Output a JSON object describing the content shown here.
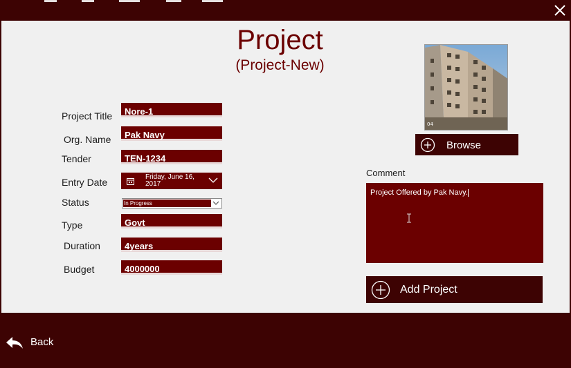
{
  "window": {
    "close_icon": "close-icon"
  },
  "header": {
    "title": "Project",
    "subtitle": "(Project-New)"
  },
  "form": {
    "project_title_label": "Project Title",
    "project_title_value": "Nore-1",
    "org_name_label": "Org. Name",
    "org_name_value": "Pak Navy",
    "tender_label": "Tender",
    "tender_value": "TEN-1234",
    "entry_date_label": "Entry Date",
    "entry_date_value": "Friday, June 16, 2017",
    "status_label": "Status",
    "status_value": "In Progress",
    "type_label": "Type",
    "type_value": "Govt",
    "duration_label": "Duration",
    "duration_value": "4years",
    "budget_label": "Budget",
    "budget_value": "4000000"
  },
  "photo": {
    "overlay_text": "04"
  },
  "buttons": {
    "browse": "Browse",
    "add_project": "Add Project",
    "back": "Back"
  },
  "comment": {
    "label": "Comment",
    "value": "Project Offered by Pak Navy."
  },
  "colors": {
    "dark": "#3d0303",
    "field": "#6b0000",
    "title": "#6b0000",
    "background": "#f0f0f0"
  }
}
